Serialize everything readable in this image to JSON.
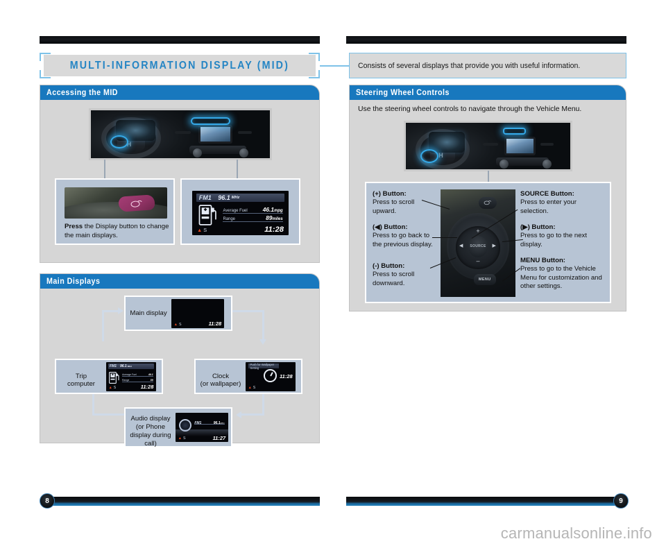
{
  "document": {
    "chapter_title": "MULTI-INFORMATION DISPLAY (MID)",
    "chapter_blurb": "Consists of several displays that provide you with useful information.",
    "page_left": "8",
    "page_right": "9",
    "watermark": "carmanualsonline.info"
  },
  "accessing": {
    "header": "Accessing the MID",
    "press_caption_bold": "Press",
    "press_caption_rest": " the Display button to change the main displays."
  },
  "main_displays": {
    "header": "Main Displays",
    "nodes": [
      {
        "label": "Main display"
      },
      {
        "label": "Clock\n(or wallpaper)"
      },
      {
        "label": "Audio display\n(or Phone\ndisplay during\ncall)"
      },
      {
        "label": "Trip\ncomputer"
      }
    ]
  },
  "steering": {
    "header": "Steering Wheel Controls",
    "intro": "Use the steering wheel controls to navigate through the Vehicle Menu.",
    "callouts_left": [
      {
        "title": "(+) Button:",
        "body": "Press to scroll upward."
      },
      {
        "title": "(◀) Button:",
        "body": "Press to go back to the previous display."
      },
      {
        "title": "(-) Button:",
        "body": "Press to scroll downward."
      }
    ],
    "callouts_right": [
      {
        "title": "SOURCE Button:",
        "body": "Press to enter your selection."
      },
      {
        "title": "(▶) Button:",
        "body": "Press to go to the next display."
      },
      {
        "title": "MENU Button:",
        "body": "Press to go to the Vehicle Menu for customization and other settings."
      }
    ],
    "wheel_labels": {
      "source": "SOURCE",
      "menu": "MENU",
      "plus": "+",
      "minus": "–",
      "left": "◀",
      "right": "▶"
    }
  },
  "mid_screens": {
    "trip": {
      "band": "FM1",
      "freq": "96.1",
      "freq_unit": "MHz",
      "row1_label": "Average Fuel",
      "row1_value": "46.1",
      "row1_unit": "mpg",
      "row2_label": "Range",
      "row2_value": "89",
      "row2_unit": "miles",
      "indicator_triangle": "▲",
      "indicator_letter": "S",
      "clock": "11:28"
    },
    "main": {
      "indicator_triangle": "▲",
      "indicator_letter": "S",
      "clock": "11:28"
    },
    "clock": {
      "wallpaper_note": "Push for Wallpaper Setting",
      "indicator_triangle": "▲",
      "indicator_letter": "S",
      "clock": "11:28"
    },
    "audio": {
      "band": "FM1",
      "freq": "96.1",
      "freq_unit": "MHz",
      "indicator_triangle": "▲",
      "indicator_letter": "S",
      "clock": "11:27"
    }
  },
  "colors": {
    "header_blue": "#1878be",
    "title_blue": "#2585c4",
    "bracket_blue": "#7ec2e8",
    "panel_gray": "#d6d6d6",
    "subbox_blue_gray": "#b7c4d4",
    "glow_blue": "#35a9e8"
  }
}
